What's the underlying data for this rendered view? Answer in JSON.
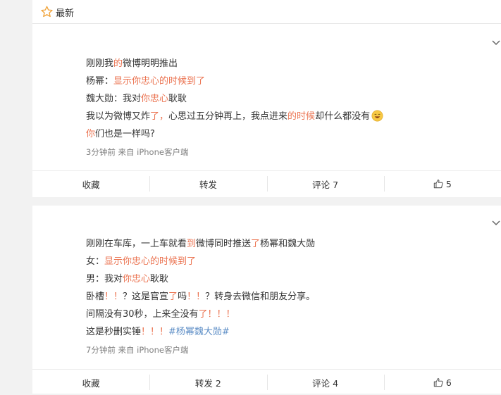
{
  "topbar": {
    "label": "最新"
  },
  "posts": [
    {
      "lines": [
        [
          {
            "t": "刚刚我",
            "c": ""
          },
          {
            "t": "的",
            "c": "r"
          },
          {
            "t": "微博明明推出",
            "c": ""
          }
        ],
        [
          {
            "t": "杨幂：",
            "c": ""
          },
          {
            "t": "显示你忠心的时候到了",
            "c": "r"
          }
        ],
        [
          {
            "t": "魏大勋：我对",
            "c": ""
          },
          {
            "t": "你忠心",
            "c": "r"
          },
          {
            "t": "耿耿",
            "c": ""
          }
        ],
        [
          {
            "t": "我以为微博又炸",
            "c": ""
          },
          {
            "t": "了，",
            "c": "r"
          },
          {
            "t": "心思过五分钟再上，我点进来",
            "c": ""
          },
          {
            "t": "的时候",
            "c": "r"
          },
          {
            "t": "却什么都没有",
            "c": ""
          }
        ],
        [
          {
            "t": "你",
            "c": "r"
          },
          {
            "t": "们也是一样吗?",
            "c": ""
          }
        ]
      ],
      "meta": "3分钟前  来自 iPhone客户端",
      "actions": {
        "favorite": "收藏",
        "repost": "转发",
        "comment": "评论 7",
        "like": "5"
      }
    },
    {
      "lines": [
        [
          {
            "t": "刚刚在车库，一上车就看",
            "c": ""
          },
          {
            "t": "到",
            "c": "r"
          },
          {
            "t": "微博同时推送",
            "c": ""
          },
          {
            "t": "了",
            "c": "r"
          },
          {
            "t": "杨幂和魏大勋",
            "c": ""
          }
        ],
        [
          {
            "t": "女：",
            "c": ""
          },
          {
            "t": "显示你忠心的时候到了",
            "c": "r"
          }
        ],
        [
          {
            "t": "男：我对",
            "c": ""
          },
          {
            "t": "你忠心",
            "c": "r"
          },
          {
            "t": "耿耿",
            "c": ""
          }
        ],
        [
          {
            "t": "卧槽",
            "c": ""
          },
          {
            "t": "！！",
            "c": "r"
          },
          {
            "t": "？这是官宣",
            "c": ""
          },
          {
            "t": "了",
            "c": "r"
          },
          {
            "t": "吗",
            "c": ""
          },
          {
            "t": "！！",
            "c": "r"
          },
          {
            "t": "？转身去微信和朋友分享。",
            "c": ""
          }
        ],
        [
          {
            "t": "间隔没有30秒，上来全没有",
            "c": ""
          },
          {
            "t": "了！！！",
            "c": "r"
          }
        ],
        [
          {
            "t": "这是秒删实锤",
            "c": ""
          },
          {
            "t": "！！！",
            "c": "r"
          },
          {
            "t": "#杨幂魏大勋#",
            "c": "link"
          }
        ]
      ],
      "meta": "7分钟前  来自 iPhone客户端",
      "actions": {
        "favorite": "收藏",
        "repost": "转发 2",
        "comment": "评论 4",
        "like": "6"
      }
    }
  ]
}
